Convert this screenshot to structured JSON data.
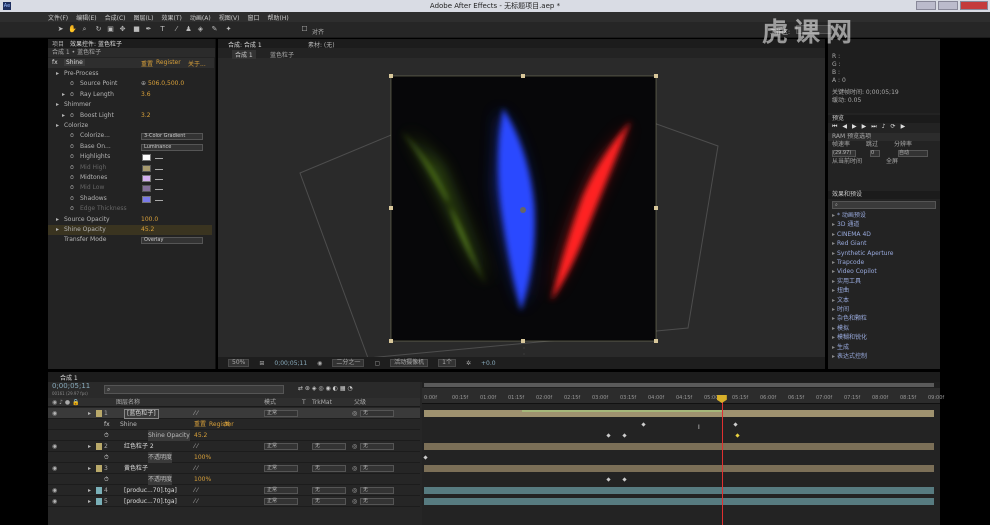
{
  "title": "Adobe After Effects - 无标题项目.aep *",
  "menu": [
    "文件(F)",
    "编辑(E)",
    "合成(C)",
    "图层(L)",
    "效果(T)",
    "动画(A)",
    "视图(V)",
    "窗口",
    "帮助(H)"
  ],
  "toolbar": {
    "align_label": "对齐",
    "workspace_label": "工作区:",
    "workspace_value": ""
  },
  "left_panel": {
    "tabs": [
      "项目",
      "效果控件: 蓝色粒子"
    ],
    "breadcrumb": "合成 1 • 蓝色粒子",
    "effect": {
      "name": "Shine",
      "reset": "重置",
      "register": "Register",
      "about": "关于..."
    },
    "rows": [
      {
        "label": "Pre-Process",
        "value": "",
        "indent": 1,
        "tw": true
      },
      {
        "label": "Source Point",
        "value": "506.0,500.0",
        "indent": 2,
        "kind": "point"
      },
      {
        "label": "Ray Length",
        "value": "3.6",
        "indent": 2,
        "tw": true
      },
      {
        "label": "Shimmer",
        "value": "",
        "indent": 1,
        "tw": true
      },
      {
        "label": "Boost Light",
        "value": "3.2",
        "indent": 2,
        "tw": true
      },
      {
        "label": "Colorize",
        "value": "",
        "indent": 1,
        "tw": true,
        "open": true
      },
      {
        "label": "Colorize...",
        "value": "3-Color Gradient",
        "indent": 2,
        "kind": "select"
      },
      {
        "label": "Base On...",
        "value": "Luminance",
        "indent": 2,
        "kind": "select"
      },
      {
        "label": "Highlights",
        "value": "#ffffff",
        "indent": 2,
        "kind": "color"
      },
      {
        "label": "Mid High",
        "value": "#ffe9a0",
        "indent": 2,
        "kind": "color",
        "dim": true
      },
      {
        "label": "Midtones",
        "value": "#d4b0f0",
        "indent": 2,
        "kind": "color"
      },
      {
        "label": "Mid Low",
        "value": "#c3a2e8",
        "indent": 2,
        "kind": "color",
        "dim": true
      },
      {
        "label": "Shadows",
        "value": "#7a7ae8",
        "indent": 2,
        "kind": "color"
      },
      {
        "label": "Edge Thickness",
        "value": "",
        "indent": 2,
        "dim": true
      },
      {
        "label": "Source Opacity",
        "value": "100.0",
        "indent": 1,
        "tw": true
      },
      {
        "label": "Shine Opacity",
        "value": "45.2",
        "indent": 1,
        "tw": true,
        "hl": true
      },
      {
        "label": "Transfer Mode",
        "value": "Overlay",
        "indent": 1,
        "kind": "select"
      }
    ]
  },
  "comp": {
    "tabs": [
      "合成: 合成 1",
      "素材: (无)"
    ],
    "sub_tabs": [
      "合成 1",
      "蓝色粒子"
    ],
    "zoom": "50%",
    "timecode": "0;00;05;11",
    "quality": "二分之一",
    "camera": "活动摄像机",
    "views": "1个",
    "exposure": "+0.0"
  },
  "right_panel": {
    "info": [
      "R :",
      "G :",
      "B :",
      "A : 0",
      "关键帧时间: 0;00;05;19",
      "缓动: 0.05"
    ],
    "preview_tab": "预览",
    "ram_label": "RAM 预览选项",
    "fps_label": "帧速率",
    "skip_label": "跳过",
    "res_label": "分辨率",
    "fps_value": "(29.97)",
    "skip_value": "0",
    "res_value": "自动",
    "from_current": "从当前时间",
    "full_screen": "全屏",
    "effects_tab": "效果和预设",
    "effects_search": "",
    "effects": [
      "* 动画预设",
      "3D 通道",
      "CINEMA 4D",
      "Red Giant",
      "Synthetic Aperture",
      "Trapcode",
      "Video Copilot",
      "实用工具",
      "扭曲",
      "文本",
      "时间",
      "杂色和颗粒",
      "模拟",
      "模糊和锐化",
      "生成",
      "表达式控制"
    ]
  },
  "timeline": {
    "tab": "合成 1",
    "timecode": "0;00;05;11",
    "frames": "00161 (29.97 fps)",
    "search": "",
    "cols": [
      "图层名称",
      "模式",
      "T",
      "TrkMat",
      "父级"
    ],
    "layers": [
      {
        "num": "1",
        "name": "[蓝色粒子]",
        "mode": "正常",
        "trk": "",
        "parent": "无",
        "color": "#b9a96a",
        "sel": true
      },
      {
        "name": "Shine",
        "sub": true,
        "reset": "重置",
        "register": "Register",
        "about": "关"
      },
      {
        "name": "Shine Opacity",
        "sub": true,
        "value": "45.2"
      },
      {
        "num": "2",
        "name": "红色粒子 2",
        "mode": "正常",
        "trk": "无",
        "parent": "无",
        "color": "#b9a96a"
      },
      {
        "name": "不透明度",
        "sub": true,
        "value": "100%"
      },
      {
        "num": "3",
        "name": "黄色粒子",
        "mode": "正常",
        "trk": "无",
        "parent": "无",
        "color": "#b9a96a"
      },
      {
        "name": "不透明度",
        "sub": true,
        "value": "100%"
      },
      {
        "num": "4",
        "name": "[produc...70].tga]",
        "mode": "正常",
        "trk": "无",
        "parent": "无",
        "color": "#7ab0b8"
      },
      {
        "num": "5",
        "name": "[produc...70].tga]",
        "mode": "正常",
        "trk": "无",
        "parent": "无",
        "color": "#7ab0b8"
      }
    ],
    "ruler": [
      "0:00f",
      "00:15f",
      "01:00f",
      "01:15f",
      "02:00f",
      "02:15f",
      "03:00f",
      "03:15f",
      "04:00f",
      "04:15f",
      "05:00f",
      "05:15f",
      "06:00f",
      "06:15f",
      "07:00f",
      "07:15f",
      "08:00f",
      "08:15f",
      "09:00f"
    ],
    "playhead_fraction": 0.584
  },
  "watermark": "虎课网"
}
